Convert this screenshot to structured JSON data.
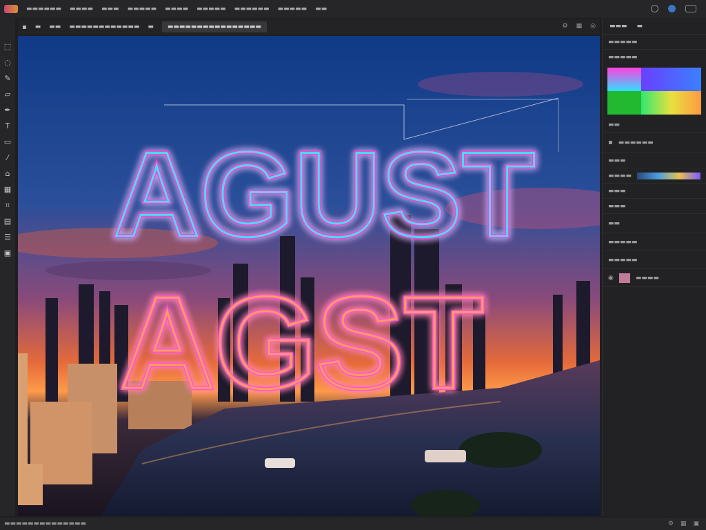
{
  "menu": {
    "items": [
      "",
      "",
      "",
      "",
      "",
      "",
      "",
      "",
      "",
      ""
    ]
  },
  "options_bar": {
    "active_tab": "",
    "items": [
      "",
      "",
      "",
      "",
      ""
    ]
  },
  "panel": {
    "tabs": [
      "",
      ""
    ],
    "sections": [
      {
        "label": ""
      },
      {
        "label": ""
      },
      {
        "label": ""
      },
      {
        "label": ""
      },
      {
        "label": ""
      },
      {
        "label": ""
      },
      {
        "label": ""
      },
      {
        "label": ""
      },
      {
        "label": ""
      },
      {
        "label": ""
      },
      {
        "label": ""
      },
      {
        "label": ""
      }
    ]
  },
  "canvas": {
    "line1": "AGUST",
    "line2": "AGST"
  },
  "tools": [
    "marquee-icon",
    "lasso-icon",
    "brush-icon",
    "eraser-icon",
    "pen-icon",
    "text-icon",
    "shape-icon",
    "eyedropper-icon",
    "clone-icon",
    "gradient-icon",
    "crop-icon",
    "zoom-icon",
    "layers-icon",
    "hand-icon"
  ],
  "status": {
    "left": "",
    "zoom": ""
  },
  "colors": {
    "accent": "#4a90d9",
    "neon_pink": "#ff3fd0",
    "neon_cyan": "#30f0ff",
    "neon_orange": "#ffb040",
    "sky_top": "#1a4a8a",
    "sunset": "#ff8a3a"
  }
}
